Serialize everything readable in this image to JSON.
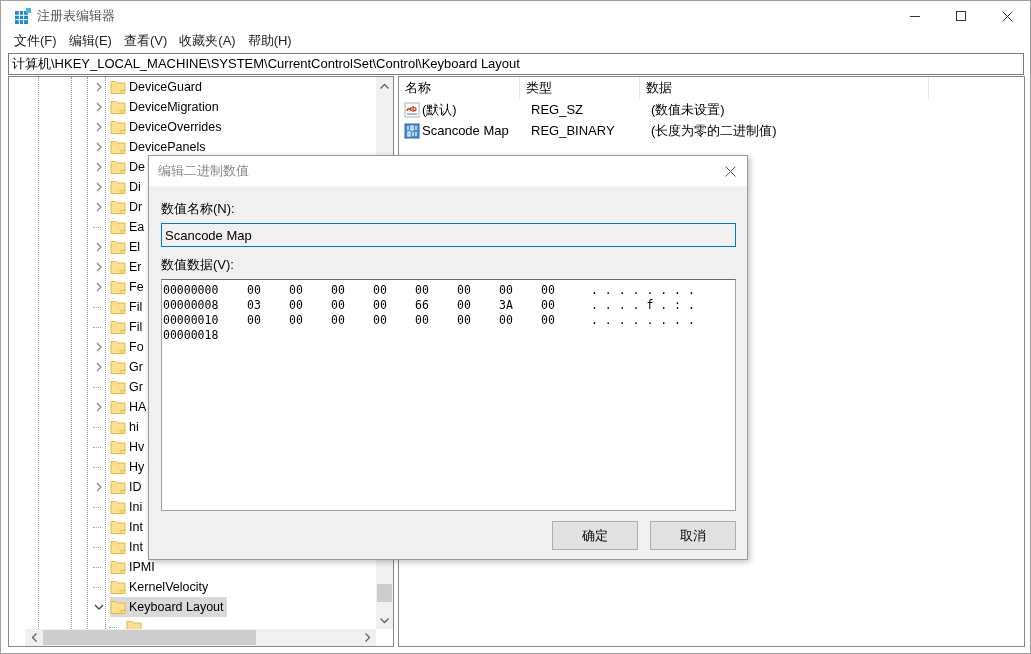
{
  "window": {
    "title": "注册表编辑器"
  },
  "menu": [
    "文件(F)",
    "编辑(E)",
    "查看(V)",
    "收藏夹(A)",
    "帮助(H)"
  ],
  "address": "计算机\\HKEY_LOCAL_MACHINE\\SYSTEM\\CurrentControlSet\\Control\\Keyboard Layout",
  "tree": {
    "items": [
      {
        "label": "DeviceGuard",
        "has_children": true,
        "expanded": false,
        "selected": false
      },
      {
        "label": "DeviceMigration",
        "has_children": true,
        "expanded": false,
        "selected": false
      },
      {
        "label": "DeviceOverrides",
        "has_children": true,
        "expanded": false,
        "selected": false
      },
      {
        "label": "DevicePanels",
        "has_children": true,
        "expanded": false,
        "selected": false
      },
      {
        "label": "De",
        "has_children": true,
        "expanded": false,
        "selected": false
      },
      {
        "label": "Di",
        "has_children": true,
        "expanded": false,
        "selected": false
      },
      {
        "label": "Dr",
        "has_children": true,
        "expanded": false,
        "selected": false
      },
      {
        "label": "Ea",
        "has_children": false,
        "selected": false
      },
      {
        "label": "El",
        "has_children": true,
        "expanded": false,
        "selected": false
      },
      {
        "label": "Er",
        "has_children": true,
        "expanded": false,
        "selected": false
      },
      {
        "label": "Fe",
        "has_children": true,
        "expanded": false,
        "selected": false
      },
      {
        "label": "Fil",
        "has_children": false,
        "selected": false
      },
      {
        "label": "Fil",
        "has_children": false,
        "selected": false
      },
      {
        "label": "Fo",
        "has_children": true,
        "expanded": false,
        "selected": false
      },
      {
        "label": "Gr",
        "has_children": true,
        "expanded": false,
        "selected": false
      },
      {
        "label": "Gr",
        "has_children": false,
        "selected": false
      },
      {
        "label": "HA",
        "has_children": true,
        "expanded": false,
        "selected": false
      },
      {
        "label": "hi",
        "has_children": false,
        "selected": false
      },
      {
        "label": "Hv",
        "has_children": false,
        "selected": false
      },
      {
        "label": "Hy",
        "has_children": false,
        "selected": false
      },
      {
        "label": "ID",
        "has_children": true,
        "expanded": false,
        "selected": false
      },
      {
        "label": "Ini",
        "has_children": false,
        "selected": false
      },
      {
        "label": "Int",
        "has_children": false,
        "selected": false
      },
      {
        "label": "Int",
        "has_children": false,
        "selected": false
      },
      {
        "label": "IPMI",
        "has_children": false,
        "selected": false
      },
      {
        "label": "KernelVelocity",
        "has_children": false,
        "selected": false
      },
      {
        "label": "Keyboard Layout",
        "has_children": true,
        "expanded": true,
        "selected": true,
        "children": [
          {
            "has_children": false,
            "selected": false
          }
        ]
      }
    ]
  },
  "values": {
    "columns": [
      "名称",
      "类型",
      "数据"
    ],
    "rows": [
      {
        "kind": "string",
        "name": "(默认)",
        "type": "REG_SZ",
        "data": "(数值未设置)"
      },
      {
        "kind": "binary",
        "name": "Scancode Map",
        "type": "REG_BINARY",
        "data": "(长度为零的二进制值)"
      }
    ]
  },
  "dialog": {
    "title": "编辑二进制数值",
    "name_label": "数值名称(N):",
    "name_value": "Scancode Map",
    "data_label": "数值数据(V):",
    "hex_rows": [
      {
        "address": "00000000",
        "bytes": [
          "00",
          "00",
          "00",
          "00",
          "00",
          "00",
          "00",
          "00"
        ],
        "ascii": ". . . . . . . ."
      },
      {
        "address": "00000008",
        "bytes": [
          "03",
          "00",
          "00",
          "00",
          "66",
          "00",
          "3A",
          "00"
        ],
        "ascii": ". . . . f . : ."
      },
      {
        "address": "00000010",
        "bytes": [
          "00",
          "00",
          "00",
          "00",
          "00",
          "00",
          "00",
          "00"
        ],
        "ascii": ". . . . . . . ."
      },
      {
        "address": "00000018"
      }
    ],
    "buttons": [
      "确定",
      "取消"
    ]
  }
}
